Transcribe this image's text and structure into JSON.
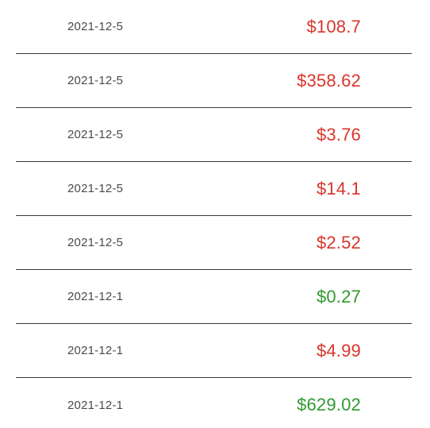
{
  "transactions": [
    {
      "date": "2021-12-5",
      "amount": "$108.7",
      "status": "negative"
    },
    {
      "date": "2021-12-5",
      "amount": "$358.62",
      "status": "negative"
    },
    {
      "date": "2021-12-5",
      "amount": "$3.76",
      "status": "negative"
    },
    {
      "date": "2021-12-5",
      "amount": "$14.1",
      "status": "negative"
    },
    {
      "date": "2021-12-5",
      "amount": "$2.52",
      "status": "negative"
    },
    {
      "date": "2021-12-1",
      "amount": "$0.27",
      "status": "positive"
    },
    {
      "date": "2021-12-1",
      "amount": "$4.99",
      "status": "negative"
    },
    {
      "date": "2021-12-1",
      "amount": "$629.02",
      "status": "positive"
    }
  ],
  "colors": {
    "negative": "#d9342b",
    "positive": "#2f9a2f",
    "divider": "#3a3a3a",
    "date_text": "#4a4a4a"
  }
}
